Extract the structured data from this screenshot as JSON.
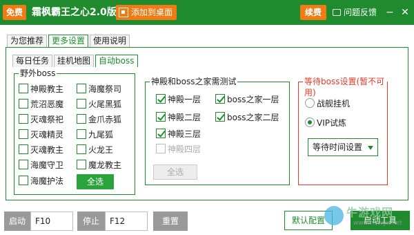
{
  "titlebar": {
    "free_badge": "免费",
    "title": "霜枫霸王之心2.0版",
    "add_to_desktop": "添加到桌面",
    "renew": "续费",
    "feedback": "问题反馈",
    "minimize": "−",
    "close": "✕",
    "color": "#1f8a2e",
    "accent": "#f07a14"
  },
  "outer_tabs": [
    "为您推荐",
    "更多设置",
    "使用说明"
  ],
  "inner_tabs": [
    "每日任务",
    "挂机地图",
    "自动boss"
  ],
  "wild_boss": {
    "title": "野外boss",
    "items": [
      {
        "label": "神殿教主",
        "checked": false
      },
      {
        "label": "海魔祭司",
        "checked": false
      },
      {
        "label": "荒沼恶魔",
        "checked": false
      },
      {
        "label": "火尾黑狐",
        "checked": false
      },
      {
        "label": "灭魂祭祀",
        "checked": false
      },
      {
        "label": "金爪赤狐",
        "checked": false
      },
      {
        "label": "灭魂精灵",
        "checked": false
      },
      {
        "label": "九尾狐",
        "checked": false
      },
      {
        "label": "灭魂教主",
        "checked": false
      },
      {
        "label": "火龙王",
        "checked": false
      },
      {
        "label": "海魔守卫",
        "checked": false
      },
      {
        "label": "魔龙教主",
        "checked": false
      },
      {
        "label": "海魔护法",
        "checked": false
      }
    ],
    "select_all": "全选"
  },
  "test_group": {
    "title": "神殿和boss之家需测试",
    "items": [
      {
        "label": "神殿一层",
        "checked": true,
        "disabled": false
      },
      {
        "label": "boss之家一层",
        "checked": true,
        "disabled": false
      },
      {
        "label": "神殿二层",
        "checked": true,
        "disabled": false
      },
      {
        "label": "boss之家二层",
        "checked": true,
        "disabled": false
      },
      {
        "label": "神殿三层",
        "checked": true,
        "disabled": false
      },
      {
        "label": "神殿四层",
        "checked": false,
        "disabled": true
      }
    ],
    "select_all": "全选"
  },
  "wait_group": {
    "title": "等待boss设置(暂不可用)",
    "radios": [
      {
        "label": "战舰挂机",
        "selected": false
      },
      {
        "label": "VIP试炼",
        "selected": true
      }
    ],
    "select_value": "等待时间设置",
    "color": "#e23b2a"
  },
  "bottom": {
    "start_label": "启动",
    "start_key": "F10",
    "stop_label": "停止",
    "stop_key": "F12",
    "reset_label": "重置",
    "default_config": "默认配置",
    "start_tool": "启动工具",
    "watermark_text": "牛游戏网",
    "watermark_url": "www.newyx.net"
  }
}
